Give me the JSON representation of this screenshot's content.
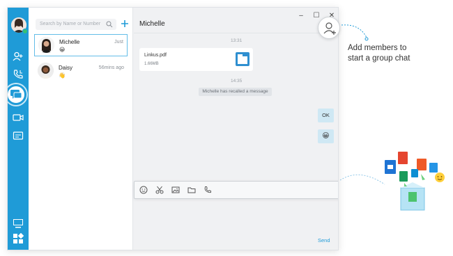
{
  "search": {
    "placeholder": "Search by Name or Number"
  },
  "chat": {
    "title": "Michelle",
    "window_controls": {
      "minimize": "–",
      "maximize": "☐",
      "close": "✕"
    },
    "time1": "13:31",
    "time2": "14:35",
    "file": {
      "name": "Linkus.pdf",
      "size": "1.66MB"
    },
    "recall_notice": "Michelle has recalled a message",
    "reply_ok": "OK",
    "reply_emoji": "😀",
    "send_label": "Send"
  },
  "contacts": [
    {
      "name": "Michelle",
      "time": "Just",
      "emoji": "😀"
    },
    {
      "name": "Daisy",
      "time": "56mins ago",
      "emoji": "👋"
    }
  ],
  "callout": {
    "line1": "Add members to",
    "line2": "start a group chat"
  },
  "colors": {
    "accent": "#1f9bd7",
    "bubble": "#cfe8f4",
    "background": "#f0f1f3"
  },
  "icons": {
    "nav": [
      "contacts-icon",
      "calls-icon",
      "chat-icon",
      "video-icon",
      "card-icon",
      "monitor-icon",
      "apps-icon"
    ],
    "composer": [
      "emoji-icon",
      "scissors-icon",
      "image-icon",
      "folder-icon",
      "phone-icon"
    ]
  }
}
